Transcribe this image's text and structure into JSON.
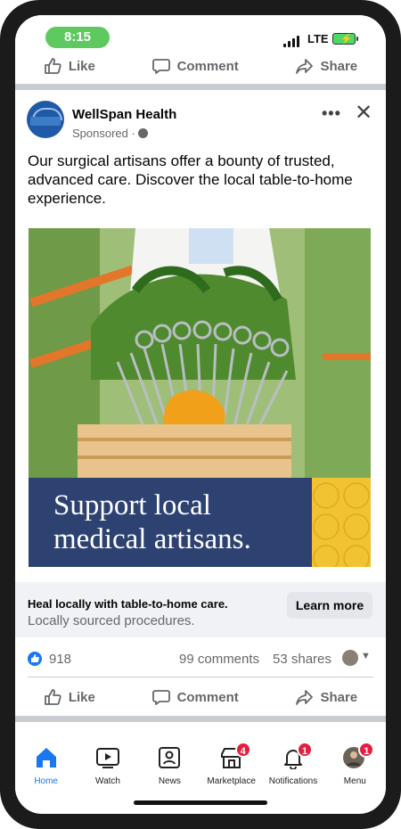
{
  "status_bar": {
    "time": "8:15",
    "network": "LTE"
  },
  "prev_post_actions": {
    "like": "Like",
    "comment": "Comment",
    "share": "Share"
  },
  "post": {
    "page_name": "WellSpan Health",
    "sponsored": "Sponsored ·",
    "more": "•••",
    "close": "✕",
    "text": "Our surgical artisans offer a bounty of trusted, advanced care. Discover the local table-to-home experience.",
    "ad_banner": {
      "line1": "Support local",
      "line2": "medical artisans."
    },
    "link": {
      "headline": "Heal locally with table-to-home care.",
      "description": "Locally sourced procedures.",
      "cta": "Learn more"
    },
    "stats": {
      "likes": "918",
      "comments": "99 comments",
      "shares": "53 shares"
    },
    "actions": {
      "like": "Like",
      "comment": "Comment",
      "share": "Share"
    }
  },
  "nav": {
    "items": [
      {
        "label": "Home",
        "icon": "home-icon",
        "active": true
      },
      {
        "label": "Watch",
        "icon": "watch-icon"
      },
      {
        "label": "News",
        "icon": "news-icon"
      },
      {
        "label": "Marketplace",
        "icon": "marketplace-icon",
        "badge": "4"
      },
      {
        "label": "Notifications",
        "icon": "bell-icon",
        "badge": "1"
      },
      {
        "label": "Menu",
        "icon": "avatar-icon",
        "badge": "1"
      }
    ]
  },
  "colors": {
    "accent": "#1877f2",
    "badge": "#e41e3f",
    "banner": "#2e4272",
    "status_pill": "#5dc95f"
  }
}
